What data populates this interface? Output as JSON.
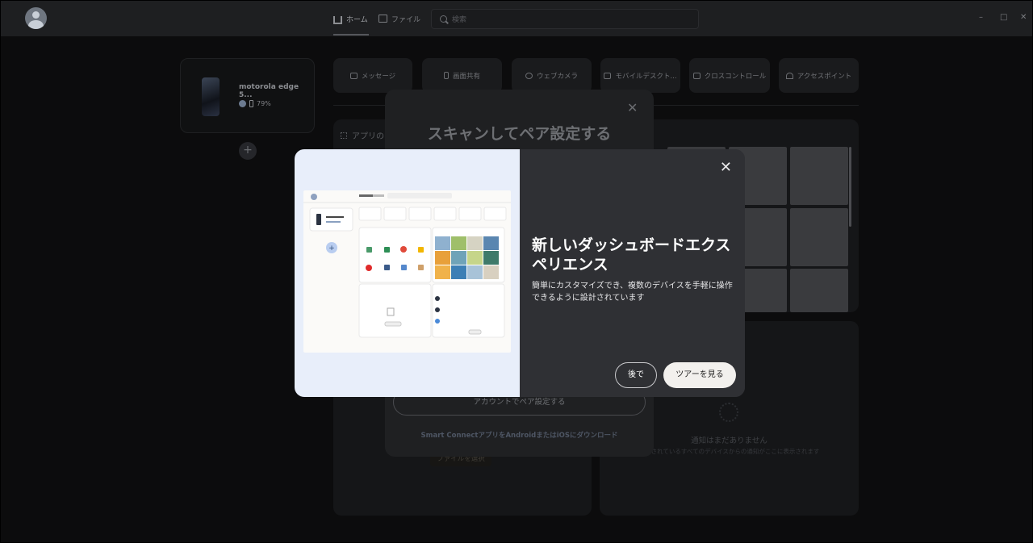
{
  "titlebar": {
    "tabs": [
      {
        "label": "ホーム",
        "icon": "home-icon"
      },
      {
        "label": "ファイル",
        "icon": "folder-icon"
      }
    ],
    "search_placeholder": "検索",
    "window_controls": {
      "minimize": "–",
      "maximize": "□",
      "close": "✕"
    }
  },
  "device": {
    "name": "motorola edge 5...",
    "battery": "79%",
    "add_label": "+"
  },
  "features": [
    {
      "label": "メッセージ",
      "icon": "message-icon"
    },
    {
      "label": "画面共有",
      "icon": "phone-screen-icon"
    },
    {
      "label": "ウェブカメラ",
      "icon": "webcam-icon"
    },
    {
      "label": "モバイルデスクト...",
      "icon": "monitor-icon"
    },
    {
      "label": "クロスコントロール",
      "icon": "cross-control-icon"
    },
    {
      "label": "アクセスポイント",
      "icon": "hotspot-icon"
    }
  ],
  "apps_panel": {
    "title": "アプリの"
  },
  "files_panel": {
    "choose_file": "ファイルを選択"
  },
  "notifications": {
    "empty_title": "通知はまだありません",
    "empty_sub": "接続されているすべてのデバイスからの通知がここに表示されます"
  },
  "scan_dialog": {
    "title": "スキャンしてペア設定する",
    "close": "✕",
    "account_button": "アカウントでペア設定する",
    "footer": "Smart ConnectアプリをAndroidまたはiOSにダウンロード"
  },
  "tour_modal": {
    "title": "新しいダッシュボードエクスペリエンス",
    "description": "簡単にカスタマイズでき、複数のデバイスを手軽に操作できるように設計されています",
    "later_button": "後で",
    "tour_button": "ツアーを見る",
    "close": "✕"
  }
}
